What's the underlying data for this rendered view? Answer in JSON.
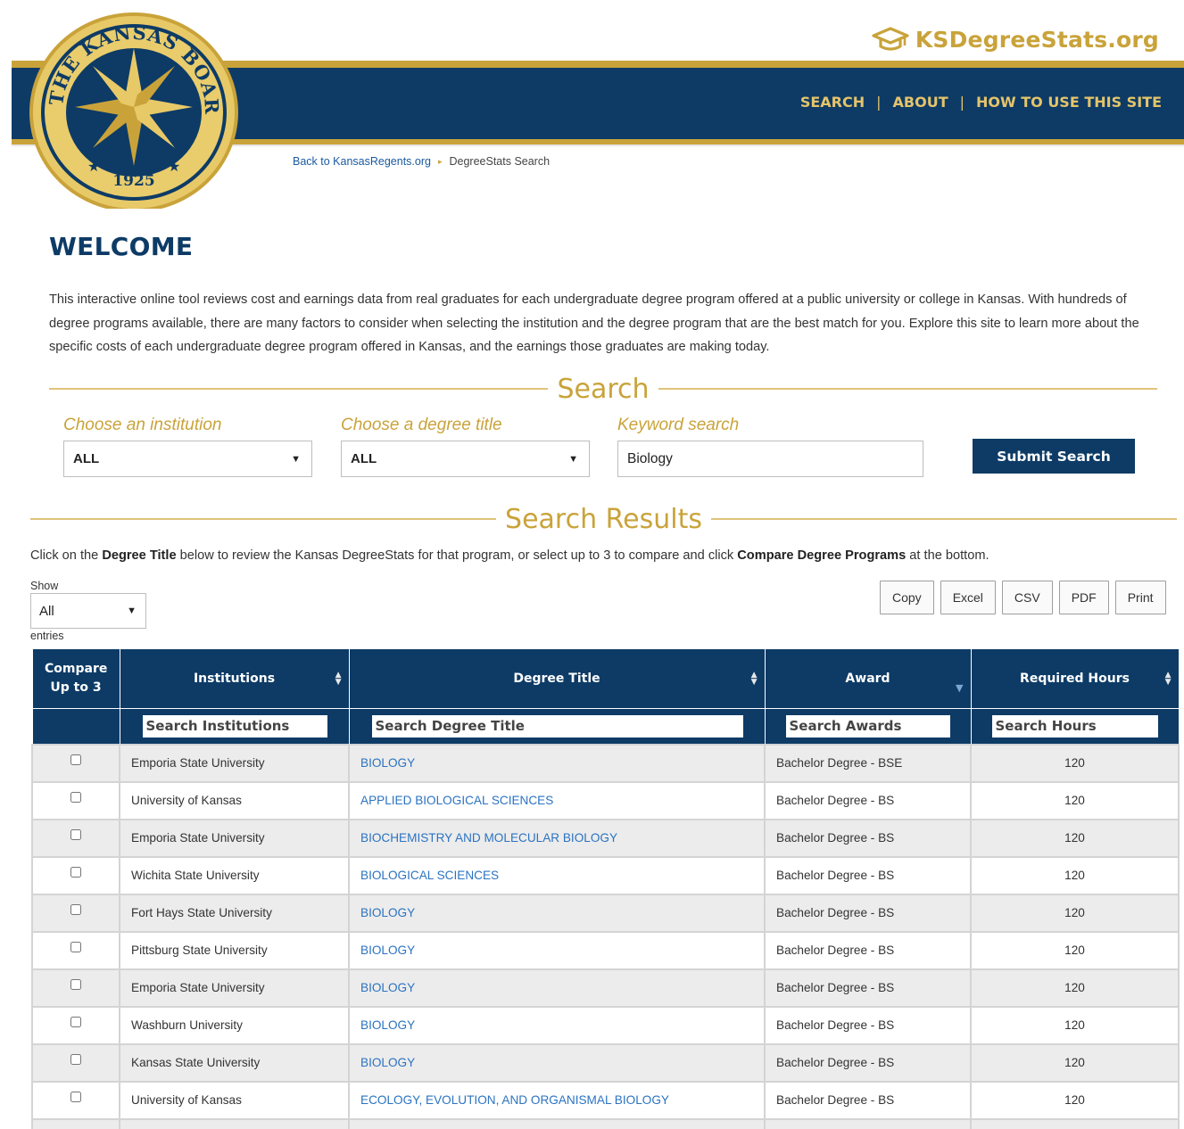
{
  "header": {
    "seal": {
      "ring_text": "THE KANSAS BOARD OF REGENTS",
      "year": "1925"
    },
    "brand": "KSDegreeStats.org",
    "nav": [
      {
        "label": "SEARCH"
      },
      {
        "label": "ABOUT"
      },
      {
        "label": "HOW TO USE THIS SITE"
      }
    ],
    "nav_separator": "|",
    "breadcrumb": {
      "back": "Back to KansasRegents.org",
      "arrow": "▸",
      "current": "DegreeStats Search"
    }
  },
  "welcome": {
    "title": "WELCOME",
    "text": "This interactive online tool reviews cost and earnings data from real graduates for each undergraduate degree program offered at a public university or college in Kansas. With hundreds of degree programs available, there are many factors to consider when selecting the institution and the degree program that are the best match for you. Explore this site to learn more about the specific costs of each undergraduate degree program offered in Kansas, and the earnings those graduates are making today."
  },
  "search": {
    "heading": "Search",
    "institution": {
      "label": "Choose an institution",
      "value": "ALL"
    },
    "degree_title": {
      "label": "Choose a degree title",
      "value": "ALL"
    },
    "keyword": {
      "label": "Keyword search",
      "value": "Biology"
    },
    "submit_label": "Submit Search"
  },
  "results": {
    "heading": "Search Results",
    "instructions": {
      "part1": "Click on the ",
      "bold1": "Degree Title",
      "part2": " below to review the Kansas DegreeStats for that program, or select up to 3 to compare and click ",
      "bold2": "Compare Degree Programs",
      "part3": " at the bottom."
    },
    "show_label": "Show",
    "entries_label": "entries",
    "length_value": "All",
    "export_buttons": [
      "Copy",
      "Excel",
      "CSV",
      "PDF",
      "Print"
    ],
    "columns": {
      "compare": "Compare Up to 3",
      "institutions": "Institutions",
      "degree_title": "Degree Title",
      "award": "Award",
      "required_hours": "Required Hours"
    },
    "filters": {
      "institutions": "Search Institutions",
      "degree_title": "Search Degree Title",
      "award": "Search Awards",
      "hours": "Search Hours"
    },
    "rows": [
      {
        "institution": "Emporia State University",
        "degree": "BIOLOGY",
        "award": "Bachelor Degree - BSE",
        "hours": "120"
      },
      {
        "institution": "University of Kansas",
        "degree": "APPLIED BIOLOGICAL SCIENCES",
        "award": "Bachelor Degree - BS",
        "hours": "120"
      },
      {
        "institution": "Emporia State University",
        "degree": "BIOCHEMISTRY AND MOLECULAR BIOLOGY",
        "award": "Bachelor Degree - BS",
        "hours": "120"
      },
      {
        "institution": "Wichita State University",
        "degree": "BIOLOGICAL SCIENCES",
        "award": "Bachelor Degree - BS",
        "hours": "120"
      },
      {
        "institution": "Fort Hays State University",
        "degree": "BIOLOGY",
        "award": "Bachelor Degree - BS",
        "hours": "120"
      },
      {
        "institution": "Pittsburg State University",
        "degree": "BIOLOGY",
        "award": "Bachelor Degree - BS",
        "hours": "120"
      },
      {
        "institution": "Emporia State University",
        "degree": "BIOLOGY",
        "award": "Bachelor Degree - BS",
        "hours": "120"
      },
      {
        "institution": "Washburn University",
        "degree": "BIOLOGY",
        "award": "Bachelor Degree - BS",
        "hours": "120"
      },
      {
        "institution": "Kansas State University",
        "degree": "BIOLOGY",
        "award": "Bachelor Degree - BS",
        "hours": "120"
      },
      {
        "institution": "University of Kansas",
        "degree": "ECOLOGY, EVOLUTION, AND ORGANISMAL BIOLOGY",
        "award": "Bachelor Degree - BS",
        "hours": "120"
      }
    ]
  },
  "icons": {
    "brand": "graduation-cap-icon",
    "dropdown": "caret-down-icon",
    "sort": "sort-arrows-icon"
  },
  "colors": {
    "navy": "#0d3b66",
    "gold": "#c9a33a",
    "link": "#2b73c2"
  }
}
